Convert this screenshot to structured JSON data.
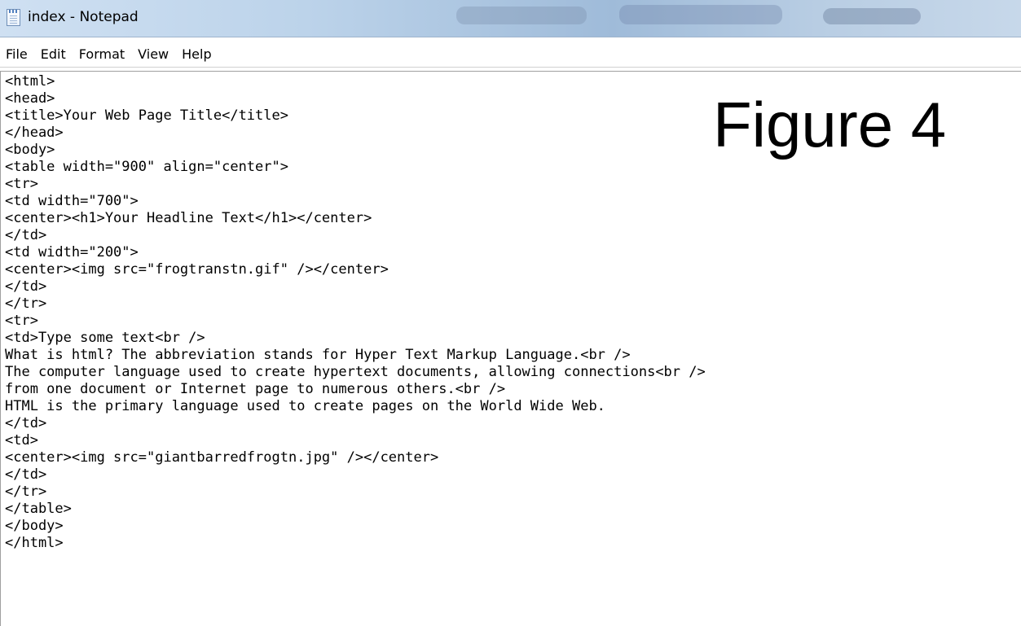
{
  "window": {
    "title": "index - Notepad",
    "icon": "notepad-icon"
  },
  "menu": {
    "items": [
      "File",
      "Edit",
      "Format",
      "View",
      "Help"
    ]
  },
  "figure_label": "Figure 4",
  "editor": {
    "lines": [
      "<html>",
      "<head>",
      "<title>Your Web Page Title</title>",
      "</head>",
      "<body>",
      "<table width=\"900\" align=\"center\">",
      "<tr>",
      "<td width=\"700\">",
      "<center><h1>Your Headline Text</h1></center>",
      "</td>",
      "<td width=\"200\">",
      "<center><img src=\"frogtranstn.gif\" /></center>",
      "</td>",
      "</tr>",
      "<tr>",
      "<td>Type some text<br />",
      "What is html? The abbreviation stands for Hyper Text Markup Language.<br />",
      "The computer language used to create hypertext documents, allowing connections<br />",
      "from one document or Internet page to numerous others.<br />",
      "HTML is the primary language used to create pages on the World Wide Web.",
      "</td>",
      "<td>",
      "<center><img src=\"giantbarredfrogtn.jpg\" /></center>",
      "</td>",
      "</tr>",
      "</table>",
      "</body>",
      "</html>"
    ]
  }
}
